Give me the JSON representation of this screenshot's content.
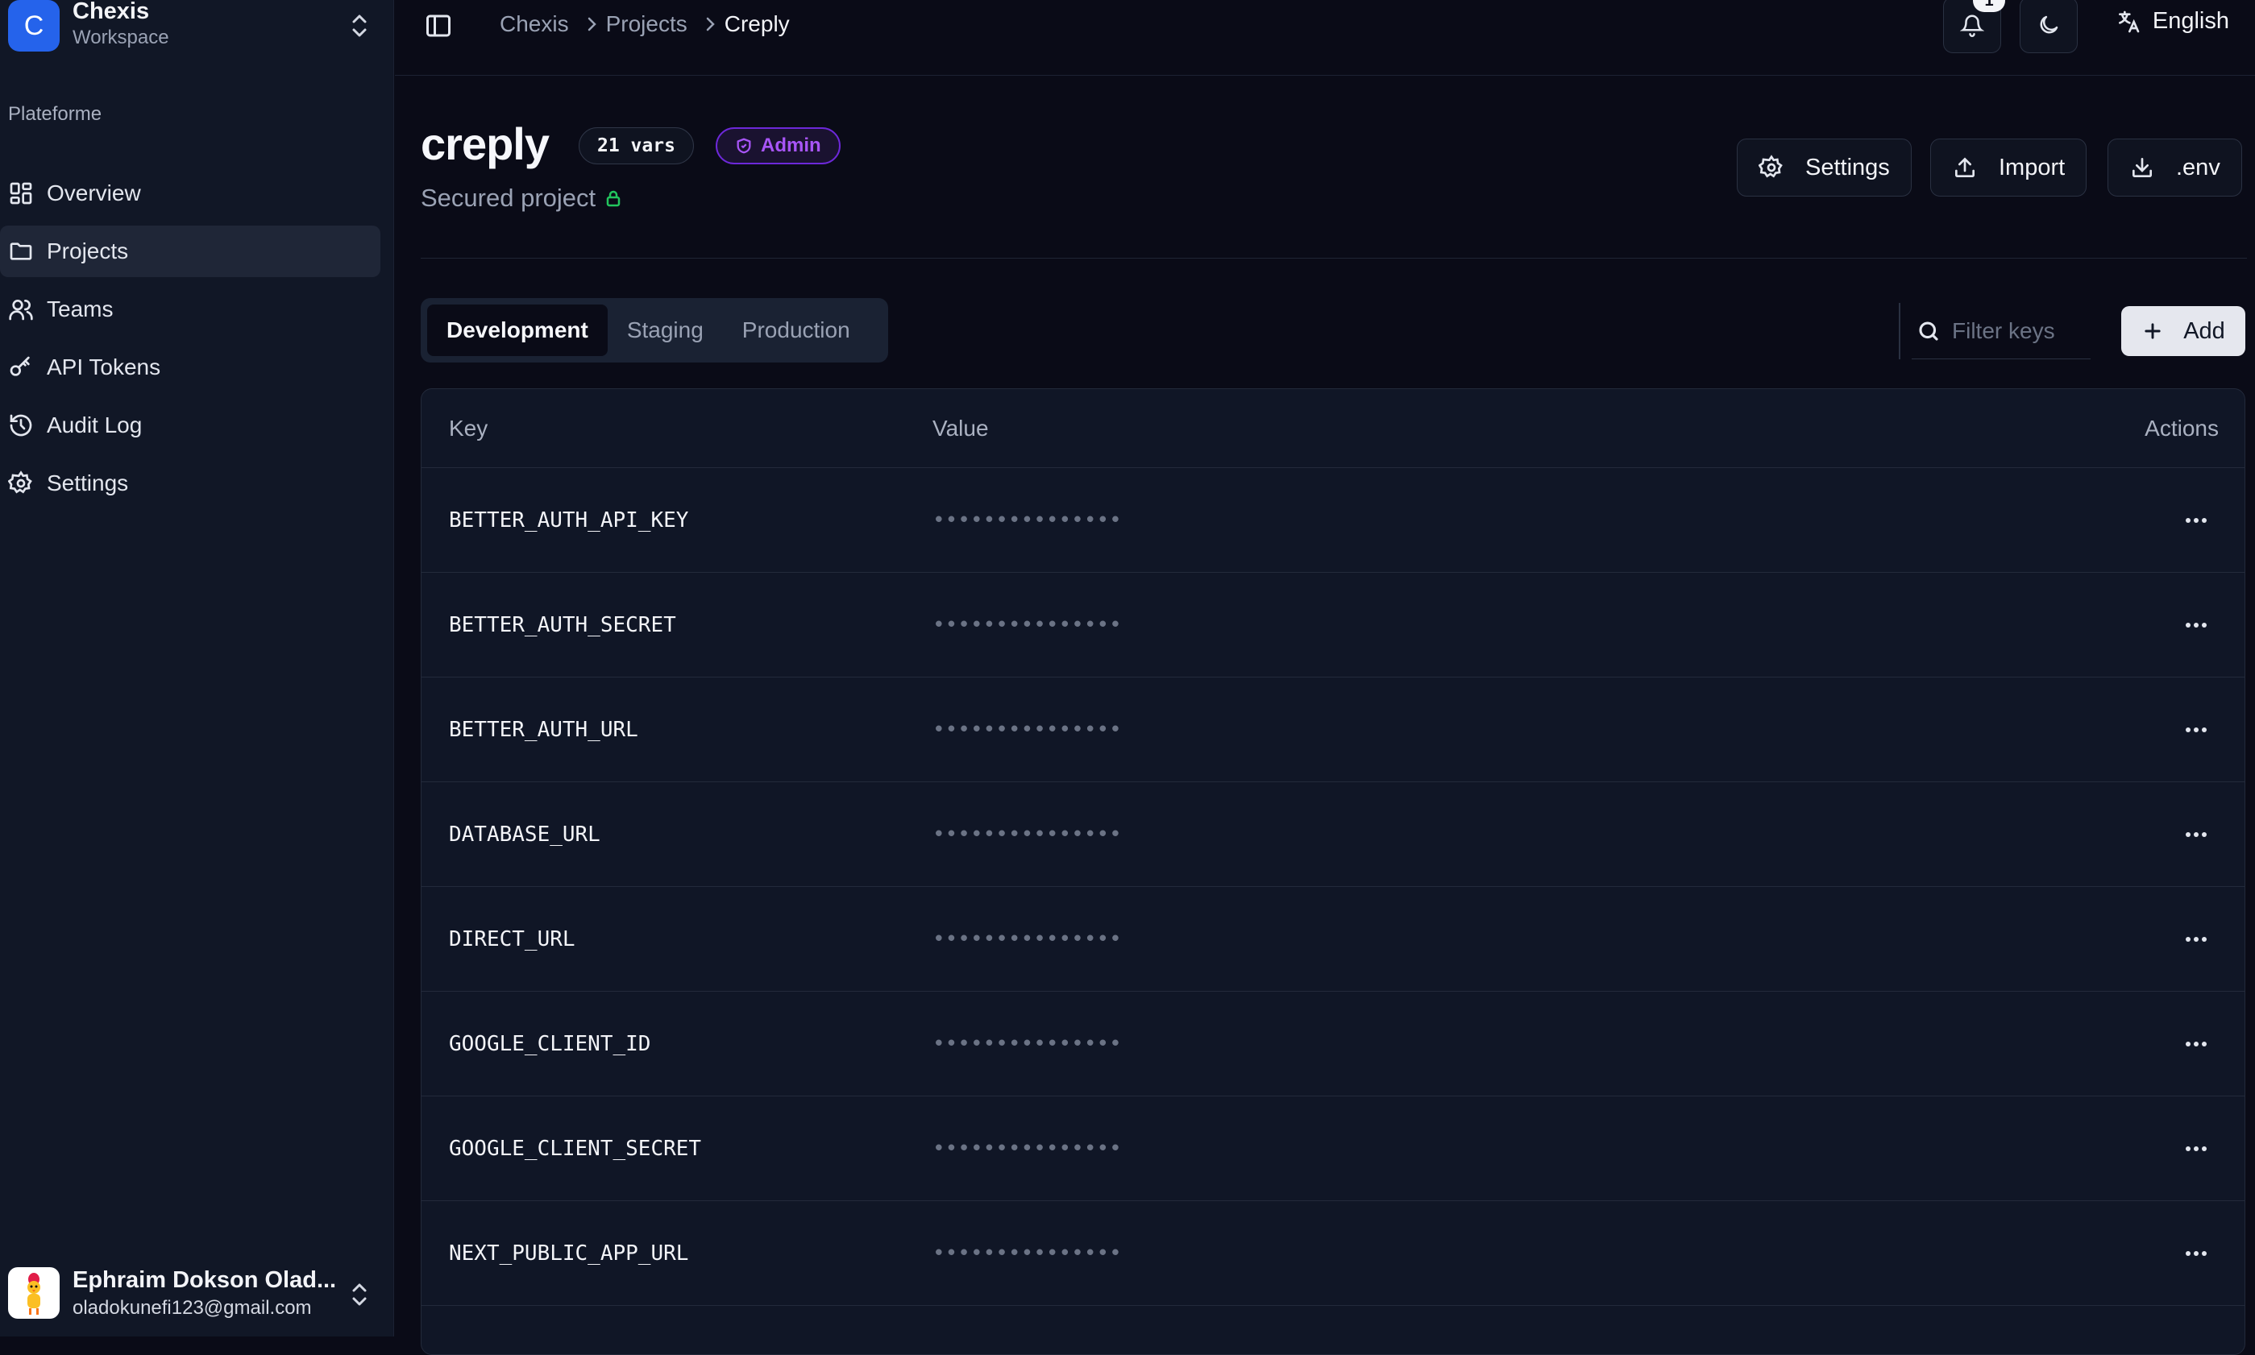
{
  "workspace": {
    "initial": "C",
    "name": "Chexis",
    "subtitle": "Workspace"
  },
  "sidebar": {
    "group_label": "Plateforme",
    "items": [
      {
        "label": "Overview",
        "icon": "dashboard-icon"
      },
      {
        "label": "Projects",
        "icon": "folder-icon",
        "active": true
      },
      {
        "label": "Teams",
        "icon": "users-icon"
      },
      {
        "label": "API Tokens",
        "icon": "key-icon"
      },
      {
        "label": "Audit Log",
        "icon": "history-icon"
      },
      {
        "label": "Settings",
        "icon": "gear-icon"
      }
    ]
  },
  "user": {
    "name": "Ephraim Dokson Olad...",
    "email": "oladokunefi123@gmail.com"
  },
  "topbar": {
    "breadcrumbs": [
      "Chexis",
      "Projects",
      "Creply"
    ],
    "notification_count": "1",
    "language": "English"
  },
  "project": {
    "name": "creply",
    "vars_badge": "21 vars",
    "role_badge": "Admin",
    "subtitle": "Secured project"
  },
  "actions": {
    "settings": "Settings",
    "import": "Import",
    "env": ".env"
  },
  "tabs": [
    {
      "label": "Development",
      "active": true
    },
    {
      "label": "Staging"
    },
    {
      "label": "Production"
    }
  ],
  "filter": {
    "placeholder": "Filter keys"
  },
  "add_label": "Add",
  "table": {
    "headers": {
      "key": "Key",
      "value": "Value",
      "actions": "Actions"
    },
    "rows": [
      {
        "key": "BETTER_AUTH_API_KEY",
        "value": "•••••••••••••••"
      },
      {
        "key": "BETTER_AUTH_SECRET",
        "value": "•••••••••••••••"
      },
      {
        "key": "BETTER_AUTH_URL",
        "value": "•••••••••••••••"
      },
      {
        "key": "DATABASE_URL",
        "value": "•••••••••••••••"
      },
      {
        "key": "DIRECT_URL",
        "value": "•••••••••••••••"
      },
      {
        "key": "GOOGLE_CLIENT_ID",
        "value": "•••••••••••••••"
      },
      {
        "key": "GOOGLE_CLIENT_SECRET",
        "value": "•••••••••••••••"
      },
      {
        "key": "NEXT_PUBLIC_APP_URL",
        "value": "•••••••••••••••"
      }
    ]
  },
  "colors": {
    "accent": "#2563eb",
    "admin": "#a855f7",
    "lock": "#22c55e",
    "background": "#0a0b17",
    "sidebar": "#111726"
  }
}
